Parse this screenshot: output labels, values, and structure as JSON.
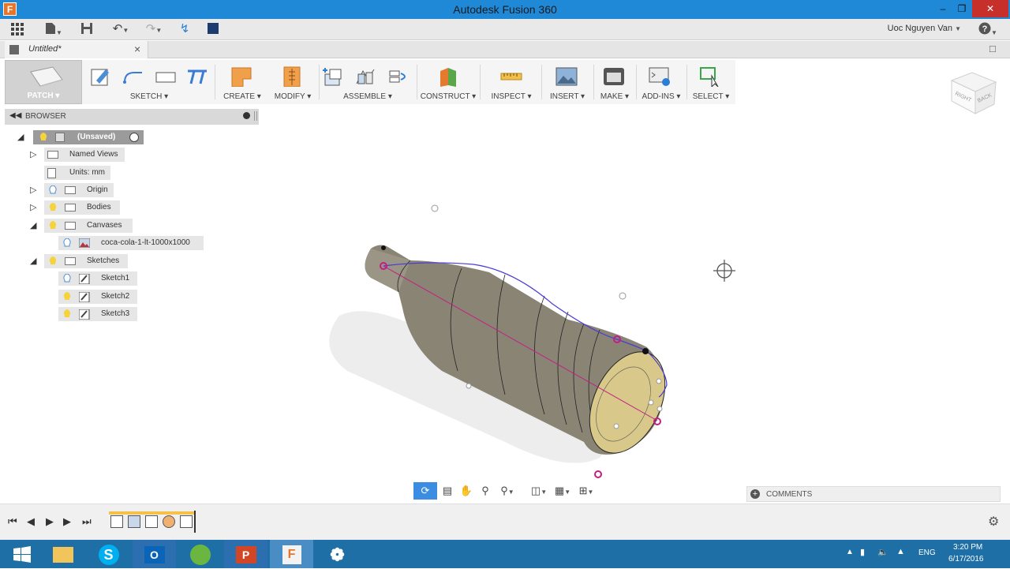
{
  "window": {
    "title": "Autodesk Fusion 360",
    "app_icon_letter": "F"
  },
  "quickbar": {
    "user_name": "Uoc Nguyen Van"
  },
  "document_tab": {
    "label": "Untitled*"
  },
  "toolbar": {
    "groups": [
      {
        "label": "PATCH",
        "icon": "patch-workspace-icon"
      },
      {
        "label": "SKETCH",
        "icon": "sketch-icon"
      },
      {
        "label": "CREATE",
        "icon": "create-icon"
      },
      {
        "label": "MODIFY",
        "icon": "modify-icon"
      },
      {
        "label": "ASSEMBLE",
        "icon": "assemble-icon"
      },
      {
        "label": "CONSTRUCT",
        "icon": "construct-icon"
      },
      {
        "label": "INSPECT",
        "icon": "inspect-icon"
      },
      {
        "label": "INSERT",
        "icon": "insert-icon"
      },
      {
        "label": "MAKE",
        "icon": "make-icon"
      },
      {
        "label": "ADD-INS",
        "icon": "add-ins-icon"
      },
      {
        "label": "SELECT",
        "icon": "select-icon"
      }
    ]
  },
  "browser": {
    "title": "BROWSER",
    "root": "(Unsaved)",
    "named_views": "Named Views",
    "units": "Units: mm",
    "origin": "Origin",
    "bodies": "Bodies",
    "canvases": "Canvases",
    "canvas_item": "coca-cola-1-lt-1000x1000",
    "sketches": "Sketches",
    "sketch_items": [
      "Sketch1",
      "Sketch2",
      "Sketch3"
    ]
  },
  "viewcube": {
    "face_right": "RIGHT",
    "face_back": "BACK"
  },
  "comments": {
    "label": "COMMENTS"
  },
  "taskbar": {
    "language": "ENG",
    "time": "3:20 PM",
    "date": "6/17/2016"
  },
  "colors": {
    "titlebar": "#1f89d8",
    "taskbar": "#1d6fa6",
    "body_fill": "#8a8474",
    "inner_fill": "#d8c98a",
    "sketch_curve": "#4a3ad6",
    "constraint_point": "#c21f86"
  }
}
